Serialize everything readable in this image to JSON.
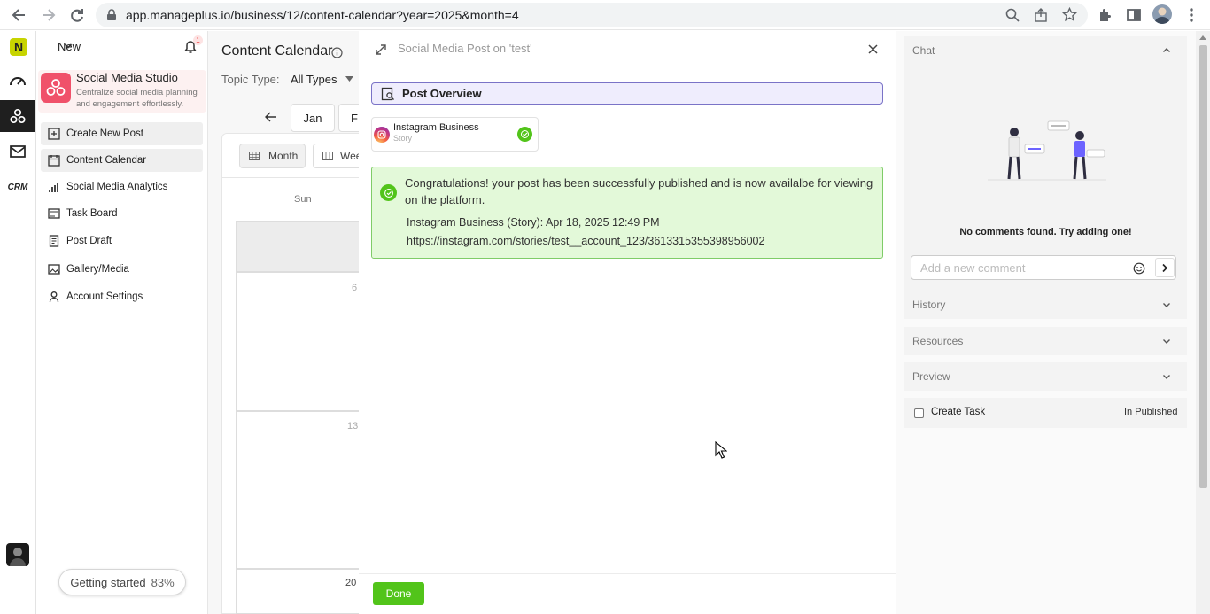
{
  "browser": {
    "url": "app.manageplus.io/business/12/content-calendar?year=2025&month=4"
  },
  "topbar": {
    "new_label": "New",
    "notification_count": "1"
  },
  "brand": {
    "title": "Social Media Studio",
    "subtitle": "Centralize social media planning and engagement effortlessly."
  },
  "sidebar": {
    "items": [
      {
        "label": "Create New Post",
        "icon": "create-post-icon"
      },
      {
        "label": "Content Calendar",
        "icon": "calendar-icon"
      },
      {
        "label": "Social Media Analytics",
        "icon": "analytics-icon"
      },
      {
        "label": "Task Board",
        "icon": "task-board-icon"
      },
      {
        "label": "Post Draft",
        "icon": "draft-icon"
      },
      {
        "label": "Gallery/Media",
        "icon": "gallery-icon"
      },
      {
        "label": "Account Settings",
        "icon": "user-icon"
      }
    ]
  },
  "rail": {
    "crm_label": "CRM"
  },
  "getting_started": {
    "label": "Getting started",
    "percent": "83%"
  },
  "calendar": {
    "title": "Content Calendar",
    "topic_type_label": "Topic Type:",
    "topic_type_value": "All Types",
    "month_jan": "Jan",
    "month_next": "F",
    "view_month": "Month",
    "view_week": "Wee",
    "day_sun": "Sun",
    "dates": [
      "6",
      "13",
      "20"
    ]
  },
  "modal": {
    "title": "Social Media Post on 'test'",
    "section_title": "Post Overview",
    "platform_name": "Instagram Business",
    "platform_type": "Story",
    "success_message": "Congratulations! your post has been successfully published and is now availalbe for viewing on the platform.",
    "published_line": "Instagram Business (Story): Apr 18, 2025 12:49 PM",
    "post_url": "https://instagram.com/stories/test__account_123/3613315355398956002",
    "done_label": "Done"
  },
  "right_panel": {
    "chat_label": "Chat",
    "empty_message": "No comments found. Try adding one!",
    "comment_placeholder": "Add a new comment",
    "history_label": "History",
    "resources_label": "Resources",
    "preview_label": "Preview",
    "create_task_label": "Create Task",
    "create_task_status": "In Published"
  },
  "colors": {
    "accent_green": "#52c41a",
    "brand_pink": "#f0516a",
    "section_purple": "#7a73c7",
    "success_bg": "#e3f9d9"
  }
}
